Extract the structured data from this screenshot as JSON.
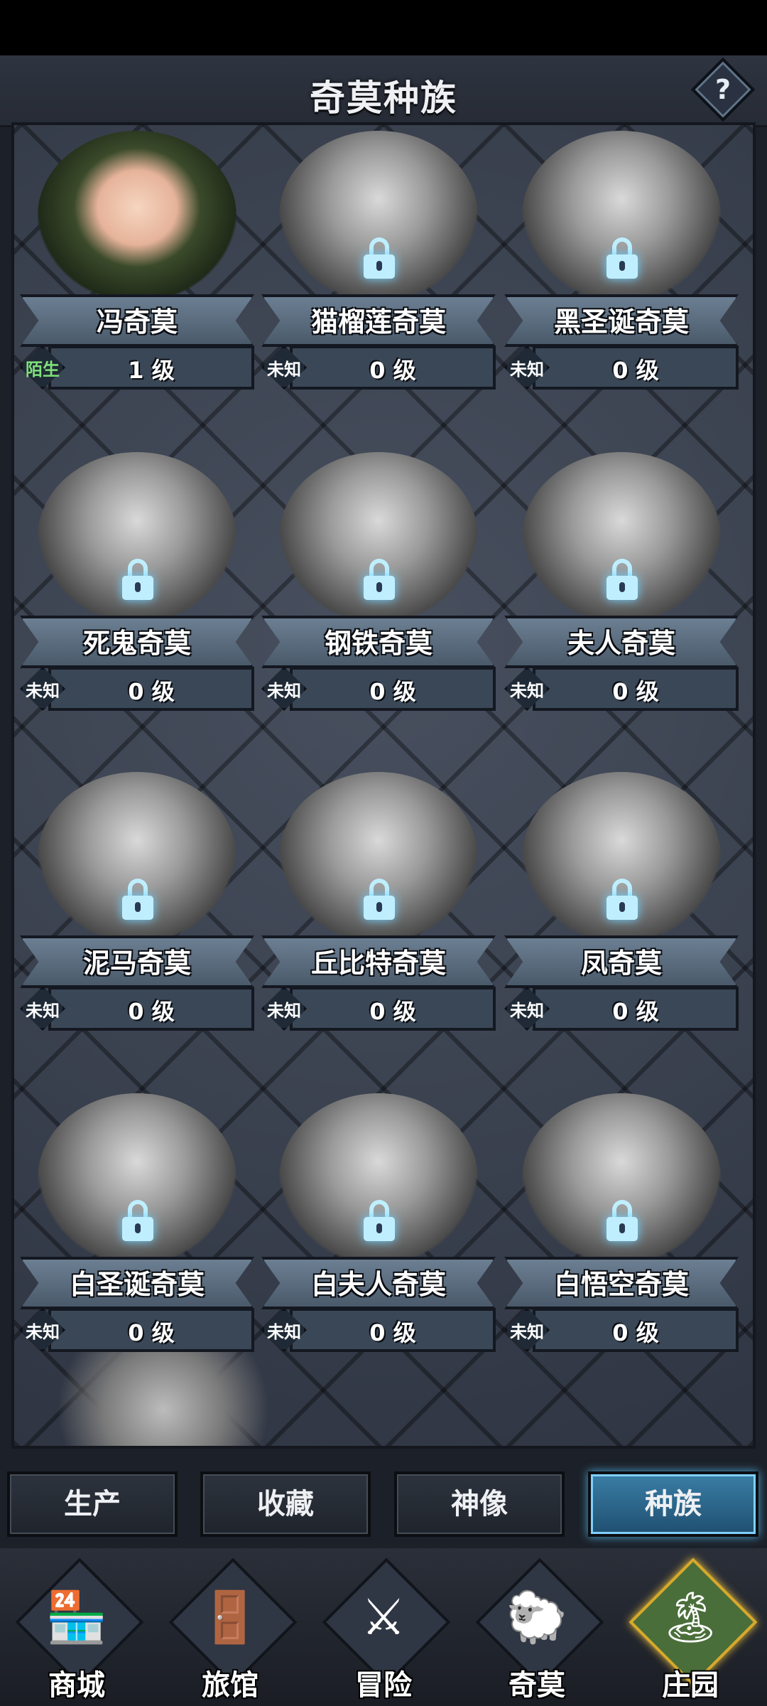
{
  "header": {
    "title": "奇莫种族",
    "help_glyph": "?"
  },
  "cards": [
    {
      "name": "冯奇莫",
      "status": "陌生",
      "level": "1",
      "level_unit": "级",
      "locked": false
    },
    {
      "name": "猫榴莲奇莫",
      "status": "未知",
      "level": "0",
      "level_unit": "级",
      "locked": true
    },
    {
      "name": "黑圣诞奇莫",
      "status": "未知",
      "level": "0",
      "level_unit": "级",
      "locked": true
    },
    {
      "name": "死鬼奇莫",
      "status": "未知",
      "level": "0",
      "level_unit": "级",
      "locked": true
    },
    {
      "name": "钢铁奇莫",
      "status": "未知",
      "level": "0",
      "level_unit": "级",
      "locked": true
    },
    {
      "name": "夫人奇莫",
      "status": "未知",
      "level": "0",
      "level_unit": "级",
      "locked": true
    },
    {
      "name": "泥马奇莫",
      "status": "未知",
      "level": "0",
      "level_unit": "级",
      "locked": true
    },
    {
      "name": "丘比特奇莫",
      "status": "未知",
      "level": "0",
      "level_unit": "级",
      "locked": true
    },
    {
      "name": "凤奇莫",
      "status": "未知",
      "level": "0",
      "level_unit": "级",
      "locked": true
    },
    {
      "name": "白圣诞奇莫",
      "status": "未知",
      "level": "0",
      "level_unit": "级",
      "locked": true
    },
    {
      "name": "白夫人奇莫",
      "status": "未知",
      "level": "0",
      "level_unit": "级",
      "locked": true
    },
    {
      "name": "白悟空奇莫",
      "status": "未知",
      "level": "0",
      "level_unit": "级",
      "locked": true
    }
  ],
  "tabs": [
    {
      "label": "生产",
      "active": false
    },
    {
      "label": "收藏",
      "active": false
    },
    {
      "label": "神像",
      "active": false
    },
    {
      "label": "种族",
      "active": true
    }
  ],
  "nav": [
    {
      "label": "商城",
      "icon": "shop-icon",
      "glyph": "🏪",
      "active": false
    },
    {
      "label": "旅馆",
      "icon": "inn-icon",
      "glyph": "🚪",
      "active": false
    },
    {
      "label": "冒险",
      "icon": "crossed-swords-icon",
      "glyph": "⚔",
      "active": false
    },
    {
      "label": "奇莫",
      "icon": "qimo-character-icon",
      "glyph": "🐑",
      "active": false
    },
    {
      "label": "庄园",
      "icon": "manor-island-icon",
      "glyph": "🏝",
      "active": true
    }
  ]
}
